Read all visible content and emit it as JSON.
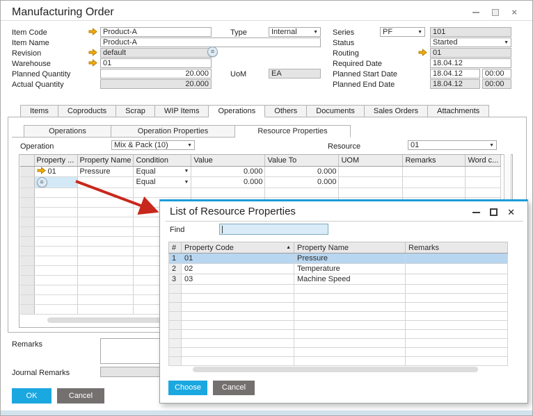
{
  "window": {
    "title": "Manufacturing Order"
  },
  "form": {
    "item_code": {
      "label": "Item Code",
      "value": "Product-A"
    },
    "item_name": {
      "label": "Item Name",
      "value": "Product-A"
    },
    "revision": {
      "label": "Revision",
      "value": "default"
    },
    "warehouse": {
      "label": "Warehouse",
      "value": "01"
    },
    "planned_quantity": {
      "label": "Planned Quantity",
      "value": "20.000"
    },
    "actual_quantity": {
      "label": "Actual Quantity",
      "value": "20.000"
    },
    "type": {
      "label": "Type",
      "value": "Internal"
    },
    "uom": {
      "label": "UoM",
      "value": "EA"
    },
    "series": {
      "label": "Series",
      "value": "PF",
      "number": "101"
    },
    "status": {
      "label": "Status",
      "value": "Started"
    },
    "routing": {
      "label": "Routing",
      "value": "01"
    },
    "required_date": {
      "label": "Required Date",
      "value": "18.04.12"
    },
    "planned_start": {
      "label": "Planned Start Date",
      "date": "18.04.12",
      "time": "00:00"
    },
    "planned_end": {
      "label": "Planned End Date",
      "date": "18.04.12",
      "time": "00:00"
    }
  },
  "tabs": {
    "items": [
      "Items",
      "Coproducts",
      "Scrap",
      "WIP Items",
      "Operations",
      "Others",
      "Documents",
      "Sales Orders",
      "Attachments"
    ],
    "active_index": 4
  },
  "subtabs": {
    "items": [
      "Operations",
      "Operation Properties",
      "Resource Properties"
    ],
    "active_index": 2
  },
  "operation_row": {
    "operation_label": "Operation",
    "operation_value": "Mix & Pack (10)",
    "resource_label": "Resource",
    "resource_value": "01"
  },
  "grid": {
    "headers": [
      "",
      "Property ...",
      "Property Name",
      "Condition",
      "Value",
      "Value To",
      "UOM",
      "Remarks",
      "Word c..."
    ],
    "rows": [
      {
        "property_code": "01",
        "property_name": "Pressure",
        "condition": "Equal",
        "value": "0.000",
        "value_to": "0.000",
        "uom": "",
        "remarks": "",
        "word": "",
        "has_arrow": true,
        "has_list_icon": false
      },
      {
        "property_code": "",
        "property_name": "",
        "condition": "Equal",
        "value": "0.000",
        "value_to": "0.000",
        "uom": "",
        "remarks": "",
        "word": "",
        "has_arrow": false,
        "has_list_icon": true
      }
    ],
    "empty_row_count": 13
  },
  "footer": {
    "remarks_label": "Remarks",
    "remarks_value": "",
    "journal_remarks_label": "Journal Remarks",
    "journal_remarks_value": "",
    "ok_label": "OK",
    "cancel_label": "Cancel"
  },
  "popup": {
    "title": "List of Resource Properties",
    "find_label": "Find",
    "find_value": "",
    "headers": [
      "#",
      "Property Code",
      "Property Name",
      "Remarks"
    ],
    "sorted_column": "Property Code",
    "rows": [
      {
        "num": "1",
        "code": "01",
        "name": "Pressure",
        "remarks": "",
        "selected": true
      },
      {
        "num": "2",
        "code": "02",
        "name": "Temperature",
        "remarks": "",
        "selected": false
      },
      {
        "num": "3",
        "code": "03",
        "name": "Machine Speed",
        "remarks": "",
        "selected": false
      }
    ],
    "empty_row_count": 9,
    "choose_label": "Choose",
    "cancel_label": "Cancel"
  },
  "icons": {
    "link_arrow": "orange-link-arrow",
    "choose_from_list": "ellipsis-circle",
    "sort_ascending": "triangle-up",
    "dropdown": "triangle-down"
  },
  "colors": {
    "accent_blue": "#1ba7e0",
    "popup_top_border": "#1b9dd9",
    "link_arrow_orange": "#f5af00",
    "annotation_arrow_red": "#c8281c",
    "selected_row_blue": "#b8d6f0",
    "selected_cell_blue": "#d4e9f6",
    "readonly_gray": "#e4e4e4"
  }
}
